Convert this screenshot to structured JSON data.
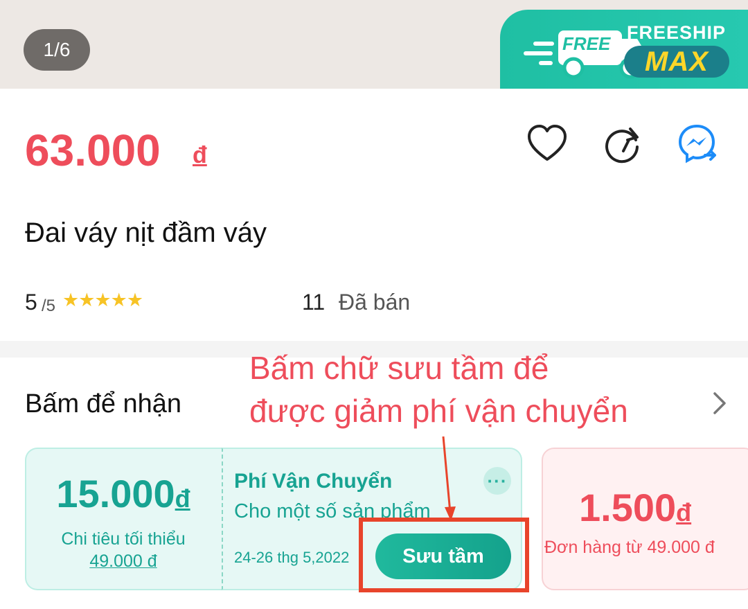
{
  "gallery": {
    "counter": "1/6",
    "badge_title": "FREESHIP",
    "badge_subtitle": "MAX",
    "truck_text": "FREE"
  },
  "product": {
    "price": "63.000",
    "currency": "đ",
    "title": "Đai váy nịt đầm váy",
    "rating": "5",
    "rating_max": "/5",
    "stars": 5,
    "sold_count": "11",
    "sold_label": "Đã bán"
  },
  "actions": {
    "icons": [
      "heart-icon",
      "share-icon",
      "messenger-icon"
    ]
  },
  "vouchers": {
    "section_title": "Bấm để nhận",
    "annotation_line1": "Bấm chữ sưu tầm để",
    "annotation_line2": "được giảm phí vận chuyển",
    "shipping": {
      "amount": "15.000",
      "currency": "đ",
      "min_label": "Chi tiêu tối thiểu",
      "min_value": "49.000 đ",
      "type": "Phí Vận Chuyển",
      "description": "Cho một số sản phẩm",
      "date": "24-26 thg 5,2022",
      "more": "···",
      "collect_label": "Sưu tầm"
    },
    "discount": {
      "amount": "1.500",
      "currency": "đ",
      "min_text": "Đơn hàng từ 49.000 đ"
    }
  },
  "colors": {
    "price": "#ee4d5b",
    "teal": "#17a392",
    "highlight": "#e8442b",
    "stars": "#f7c325"
  }
}
